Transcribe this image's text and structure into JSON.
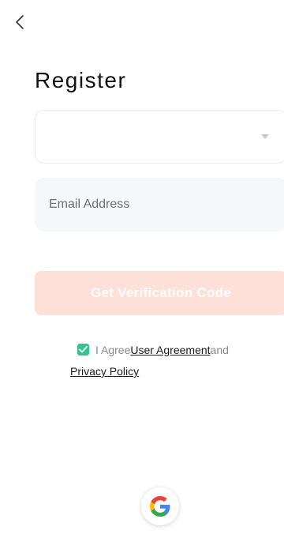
{
  "header": {
    "back_icon": "chevron-left-icon"
  },
  "page": {
    "title": "Register"
  },
  "form": {
    "region_select": {
      "value": "",
      "icon": "caret-down-icon"
    },
    "email": {
      "placeholder": "Email Address",
      "value": ""
    },
    "verify_button_label": "Get Verification Code",
    "verify_button_color": "#fde1d8"
  },
  "agreement": {
    "checked": true,
    "checkbox_color": "#34c28e",
    "prefix": "I Agree",
    "user_agreement": "User Agreement",
    "and": "and",
    "privacy_policy": "Privacy Policy"
  },
  "social": {
    "google_icon": "google-icon"
  }
}
